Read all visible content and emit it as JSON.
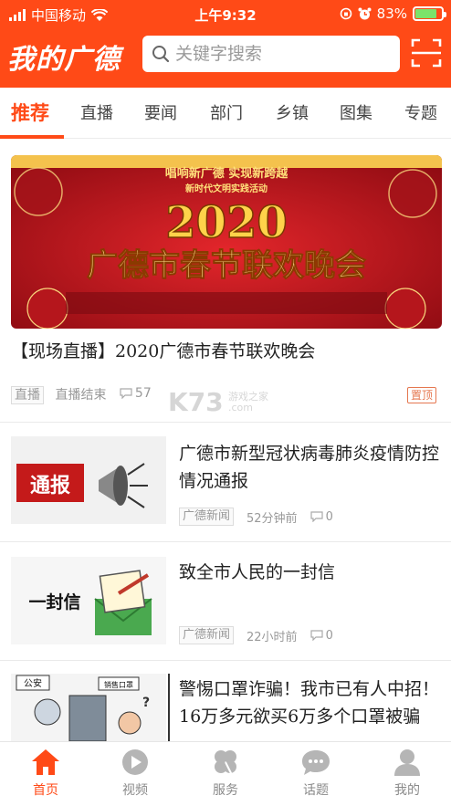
{
  "status_bar": {
    "carrier": "中国移动",
    "time": "上午9:32",
    "battery": "83%",
    "battery_level": 0.83
  },
  "header": {
    "brand": "我的广德",
    "search_placeholder": "关键字搜索"
  },
  "tabs": [
    {
      "label": "推荐",
      "active": true
    },
    {
      "label": "直播"
    },
    {
      "label": "要闻"
    },
    {
      "label": "部门"
    },
    {
      "label": "乡镇"
    },
    {
      "label": "图集"
    },
    {
      "label": "专题"
    }
  ],
  "feed": {
    "featured": {
      "banner_top": "唱响新广德 实现新跨越",
      "banner_sub": "新时代文明实践活动",
      "banner_year": "2020",
      "banner_title": "广德市春节联欢晚会",
      "headline": "【现场直播】2020广德市春节联欢晚会",
      "tag": "直播",
      "status": "直播结束",
      "comments": "57",
      "pinned": "置顶"
    },
    "items": [
      {
        "thumb_text": "通报",
        "title": "广德市新型冠状病毒肺炎疫情防控情况通报",
        "source": "广德新闻",
        "time": "52分钟前",
        "comments": "0"
      },
      {
        "thumb_text": "一封信",
        "title": "致全市人民的一封信",
        "source": "广德新闻",
        "time": "22小时前",
        "comments": "0"
      },
      {
        "thumb_text": "公安",
        "thumb_text2": "销售口罩",
        "title": "警惕口罩诈骗！我市已有人中招！16万多元欲买6万多个口罩被骗"
      }
    ]
  },
  "watermark": {
    "logo": "K73",
    "site": "游戏之家",
    "domain": ".com"
  },
  "bottom_nav": [
    {
      "label": "首页",
      "icon": "home-icon",
      "active": true
    },
    {
      "label": "视频",
      "icon": "play-icon"
    },
    {
      "label": "服务",
      "icon": "clover-icon"
    },
    {
      "label": "话题",
      "icon": "chat-icon"
    },
    {
      "label": "我的",
      "icon": "user-icon"
    }
  ],
  "colors": {
    "accent": "#ff4a17",
    "banner_red": "#c8151d",
    "banner_gold": "#f7d27a"
  }
}
